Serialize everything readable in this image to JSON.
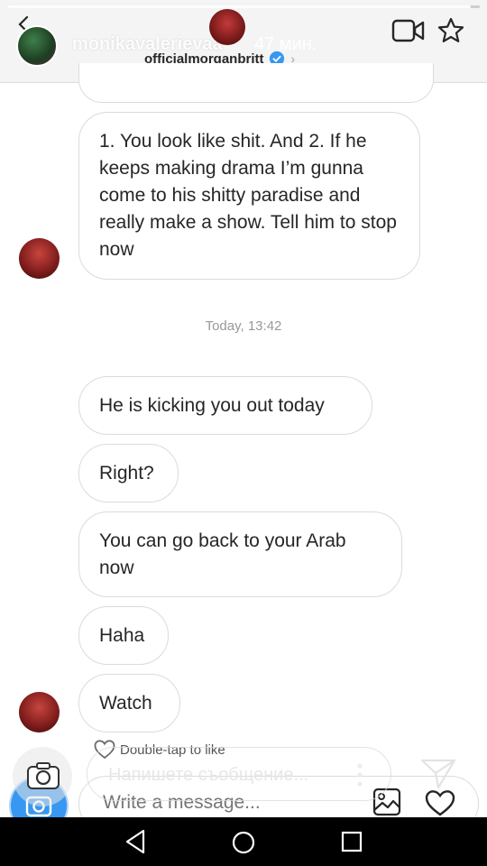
{
  "story": {
    "username": "monikavalerievaa",
    "time_ago": "47 мин.",
    "progress": 0.98,
    "reply_placeholder": "Напишете съобщение..."
  },
  "chat": {
    "username": "officialmorganbritt",
    "verified": true,
    "timestamp": "Today, 13:42",
    "messages": [
      {
        "text": "1. You look like shit. And 2. If he keeps making drama I’m gunna come to his shitty paradise and really make a show. Tell him to stop now"
      },
      {
        "text": "He is kicking you out today"
      },
      {
        "text": "Right?"
      },
      {
        "text": "You can go back to your Arab now"
      },
      {
        "text": "Haha"
      },
      {
        "text": "Watch"
      }
    ],
    "like_hint": "Double-tap to like",
    "composer_placeholder": "Write a message..."
  },
  "colors": {
    "accent": "#3897f0",
    "verified": "#3897f0",
    "bubble_border": "#dbdbdb",
    "text": "#262626",
    "timestamp": "#999999"
  },
  "icons": [
    "back-arrow-icon",
    "video-call-icon",
    "star-icon",
    "verified-icon",
    "chevron-right-icon",
    "heart-icon",
    "camera-icon",
    "send-icon",
    "more-dots-icon",
    "gallery-icon",
    "nav-back-icon",
    "nav-home-icon",
    "nav-recent-icon"
  ]
}
